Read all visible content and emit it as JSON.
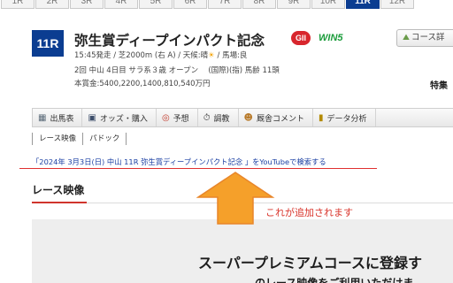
{
  "race_tabs": [
    "1R",
    "2R",
    "3R",
    "4R",
    "5R",
    "6R",
    "7R",
    "8R",
    "9R",
    "10R",
    "11R",
    "12R"
  ],
  "active_race_tab": "11R",
  "race": {
    "badge": "11R",
    "title": "弥生賞ディープインパクト記念",
    "grade": "GII",
    "win5": "WIN5",
    "course_button": "コース詳",
    "meta_line1_pre": "15:45発走 / 芝2000m (右 A) / 天候:晴",
    "meta_line1_post": " / 馬場:良",
    "meta_line2": "2回 中山 4日目 サラ系３歳 オープン　 (国際)(指) 馬齢 11頭",
    "meta_line3": "本賞金:5400,2200,1400,810,540万円",
    "special_label": "特集"
  },
  "nav_tabs": [
    {
      "icon": "▦",
      "label": "出馬表"
    },
    {
      "icon": "▣",
      "label": "オッズ・購入"
    },
    {
      "icon": "◎",
      "label": "予想"
    },
    {
      "icon": "⏱",
      "label": "調教"
    },
    {
      "icon": "☻",
      "label": "厩舎コメント"
    },
    {
      "icon": "▮",
      "label": "データ分析"
    }
  ],
  "subtabs": [
    "レース映像",
    "パドック"
  ],
  "youtube_link": "「2024年 3月3日(日) 中山 11R 弥生賞ディープインパクト記念 」をYouTubeで検索する",
  "section_title": "レース映像",
  "annotation": "これが追加されます",
  "premium": {
    "headline": "スーパープレミアムコースに登録す",
    "subline": "のレース映像をご利用いただけま"
  },
  "colors": {
    "race_badge": "#0b3d91",
    "grade_badge": "#d8262d",
    "win5": "#1b9c3b",
    "annotation": "#d9342b",
    "arrow_fill": "#f5a02a",
    "link": "#1a3fa3"
  }
}
